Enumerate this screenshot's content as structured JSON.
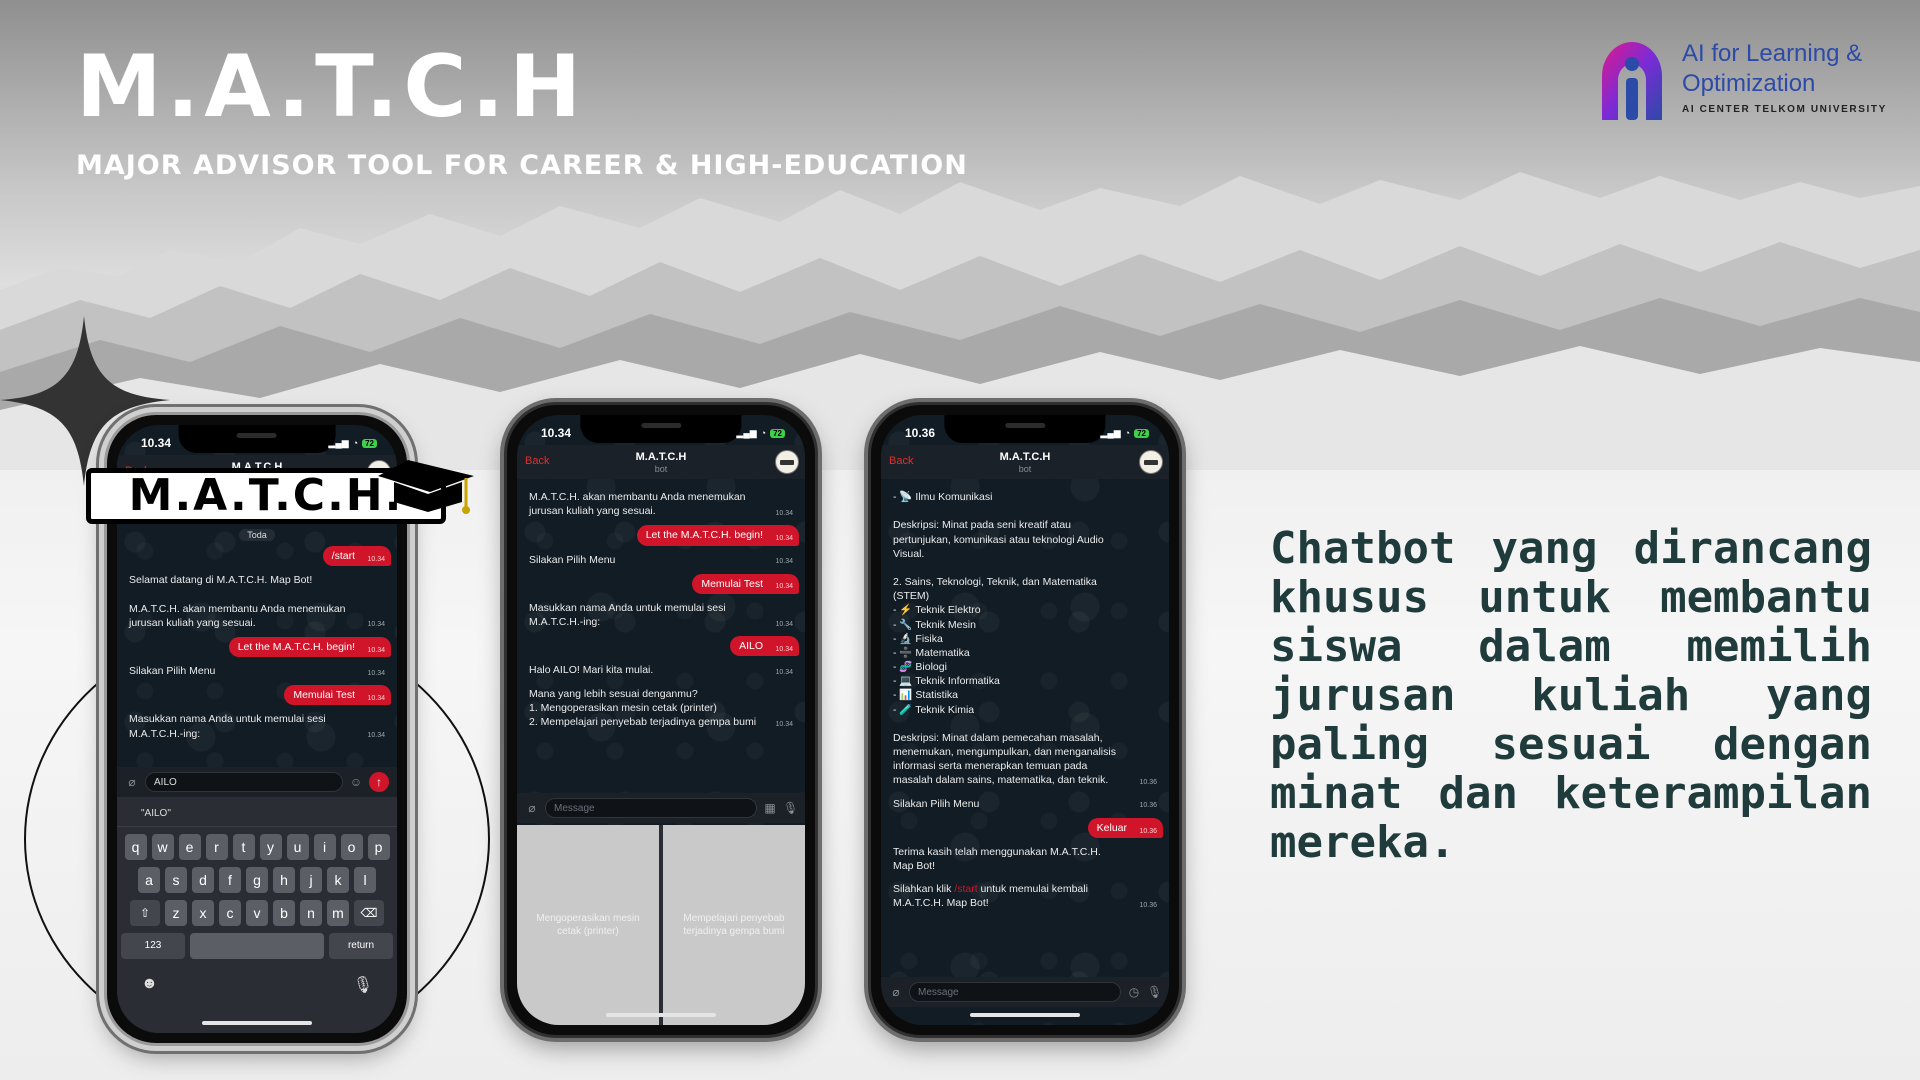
{
  "header": {
    "title": "M.A.T.C.H",
    "subtitle": "MAJOR ADVISOR TOOL FOR CAREER & HIGH-EDUCATION"
  },
  "brand": {
    "line1": "AI for Learning &",
    "line2": "Optimization",
    "line3": "AI CENTER TELKOM UNIVERSITY",
    "color": "#2c4aa8"
  },
  "sticker": {
    "text": "M.A.T.C.H."
  },
  "description": "Chatbot yang dirancang khusus untuk membantu siswa dalam memilih jurusan kuliah yang paling sesuai dengan minat dan keterampilan mereka.",
  "phones": [
    {
      "time": "10.34",
      "battery": "72",
      "header": {
        "back": "Back",
        "title": "M.A.T.C.H",
        "subtitle": "bot"
      },
      "date_chip": "Toda",
      "messages": [
        {
          "dir": "out",
          "text": "/start",
          "time": "10.34"
        },
        {
          "dir": "in",
          "text": "Selamat datang di M.A.T.C.H. Map Bot!\n\nM.A.T.C.H. akan membantu Anda menemukan jurusan kuliah yang sesuai.",
          "time": "10.34"
        },
        {
          "dir": "out",
          "text": "Let the M.A.T.C.H. begin!",
          "time": "10.34"
        },
        {
          "dir": "in",
          "text": "Silakan Pilih Menu",
          "time": "10.34"
        },
        {
          "dir": "out",
          "text": "Memulai Test",
          "time": "10.34"
        },
        {
          "dir": "in",
          "text": "Masukkan nama Anda untuk memulai sesi M.A.T.C.H.-ing:",
          "time": "10.34"
        }
      ],
      "input_value": "AILO",
      "suggestion": "\"AILO\"",
      "keyboard": {
        "row1": [
          "q",
          "w",
          "e",
          "r",
          "t",
          "y",
          "u",
          "i",
          "o",
          "p"
        ],
        "row2": [
          "a",
          "s",
          "d",
          "f",
          "g",
          "h",
          "j",
          "k",
          "l"
        ],
        "row3": [
          "z",
          "x",
          "c",
          "v",
          "b",
          "n",
          "m"
        ],
        "num": "123",
        "return": "return"
      }
    },
    {
      "time": "10.34",
      "battery": "72",
      "header": {
        "back": "Back",
        "title": "M.A.T.C.H",
        "subtitle": "bot"
      },
      "messages": [
        {
          "dir": "in",
          "text": "M.A.T.C.H. akan membantu Anda menemukan jurusan kuliah yang sesuai.",
          "time": "10.34"
        },
        {
          "dir": "out",
          "text": "Let the M.A.T.C.H. begin!",
          "time": "10.34"
        },
        {
          "dir": "in",
          "text": "Silakan Pilih Menu",
          "time": "10.34"
        },
        {
          "dir": "out",
          "text": "Memulai Test",
          "time": "10.34"
        },
        {
          "dir": "in",
          "text": "Masukkan nama Anda untuk memulai sesi M.A.T.C.H.-ing:",
          "time": "10.34"
        },
        {
          "dir": "out",
          "text": "AILO",
          "time": "10.34"
        },
        {
          "dir": "in",
          "text": "Halo AILO! Mari kita mulai.",
          "time": "10.34"
        },
        {
          "dir": "in",
          "text": "Mana yang lebih sesuai denganmu?\n1. Mengoperasikan mesin cetak (printer)\n2. Mempelajari penyebab terjadinya gempa bumi",
          "time": "10.34"
        }
      ],
      "input_placeholder": "Message",
      "buttons": [
        "Mengoperasikan mesin cetak (printer)",
        "Mempelajari penyebab terjadinya gempa bumi"
      ]
    },
    {
      "time": "10.36",
      "battery": "72",
      "header": {
        "back": "Back",
        "title": "M.A.T.C.H",
        "subtitle": "bot"
      },
      "messages": [
        {
          "dir": "in",
          "text": "- 📡 Ilmu Komunikasi\n\nDeskripsi: Minat pada seni kreatif atau pertunjukan, komunikasi atau teknologi Audio Visual.\n\n2. Sains, Teknologi, Teknik, dan Matematika (STEM)\n- ⚡ Teknik Elektro\n- 🔧 Teknik Mesin\n- 🔬 Fisika\n- ➗ Matematika\n- 🧬 Biologi\n- 💻 Teknik Informatika\n- 📊 Statistika\n- 🧪 Teknik Kimia\n\nDeskripsi: Minat dalam pemecahan masalah, menemukan, mengumpulkan, dan menganalisis informasi serta menerapkan temuan pada masalah dalam sains, matematika, dan teknik.",
          "time": "10.36"
        },
        {
          "dir": "in",
          "text": "Silakan Pilih Menu",
          "time": "10.36"
        },
        {
          "dir": "out",
          "text": "Keluar",
          "time": "10.36"
        },
        {
          "dir": "in",
          "text": "Terima kasih telah menggunakan M.A.T.C.H. Map Bot!",
          "time": ""
        }
      ],
      "final_msg": {
        "before": "Silahkan klik ",
        "link": "/start",
        "after": " untuk memulai kembali M.A.T.C.H. Map Bot!",
        "time": "10.36"
      },
      "input_placeholder": "Message"
    }
  ]
}
